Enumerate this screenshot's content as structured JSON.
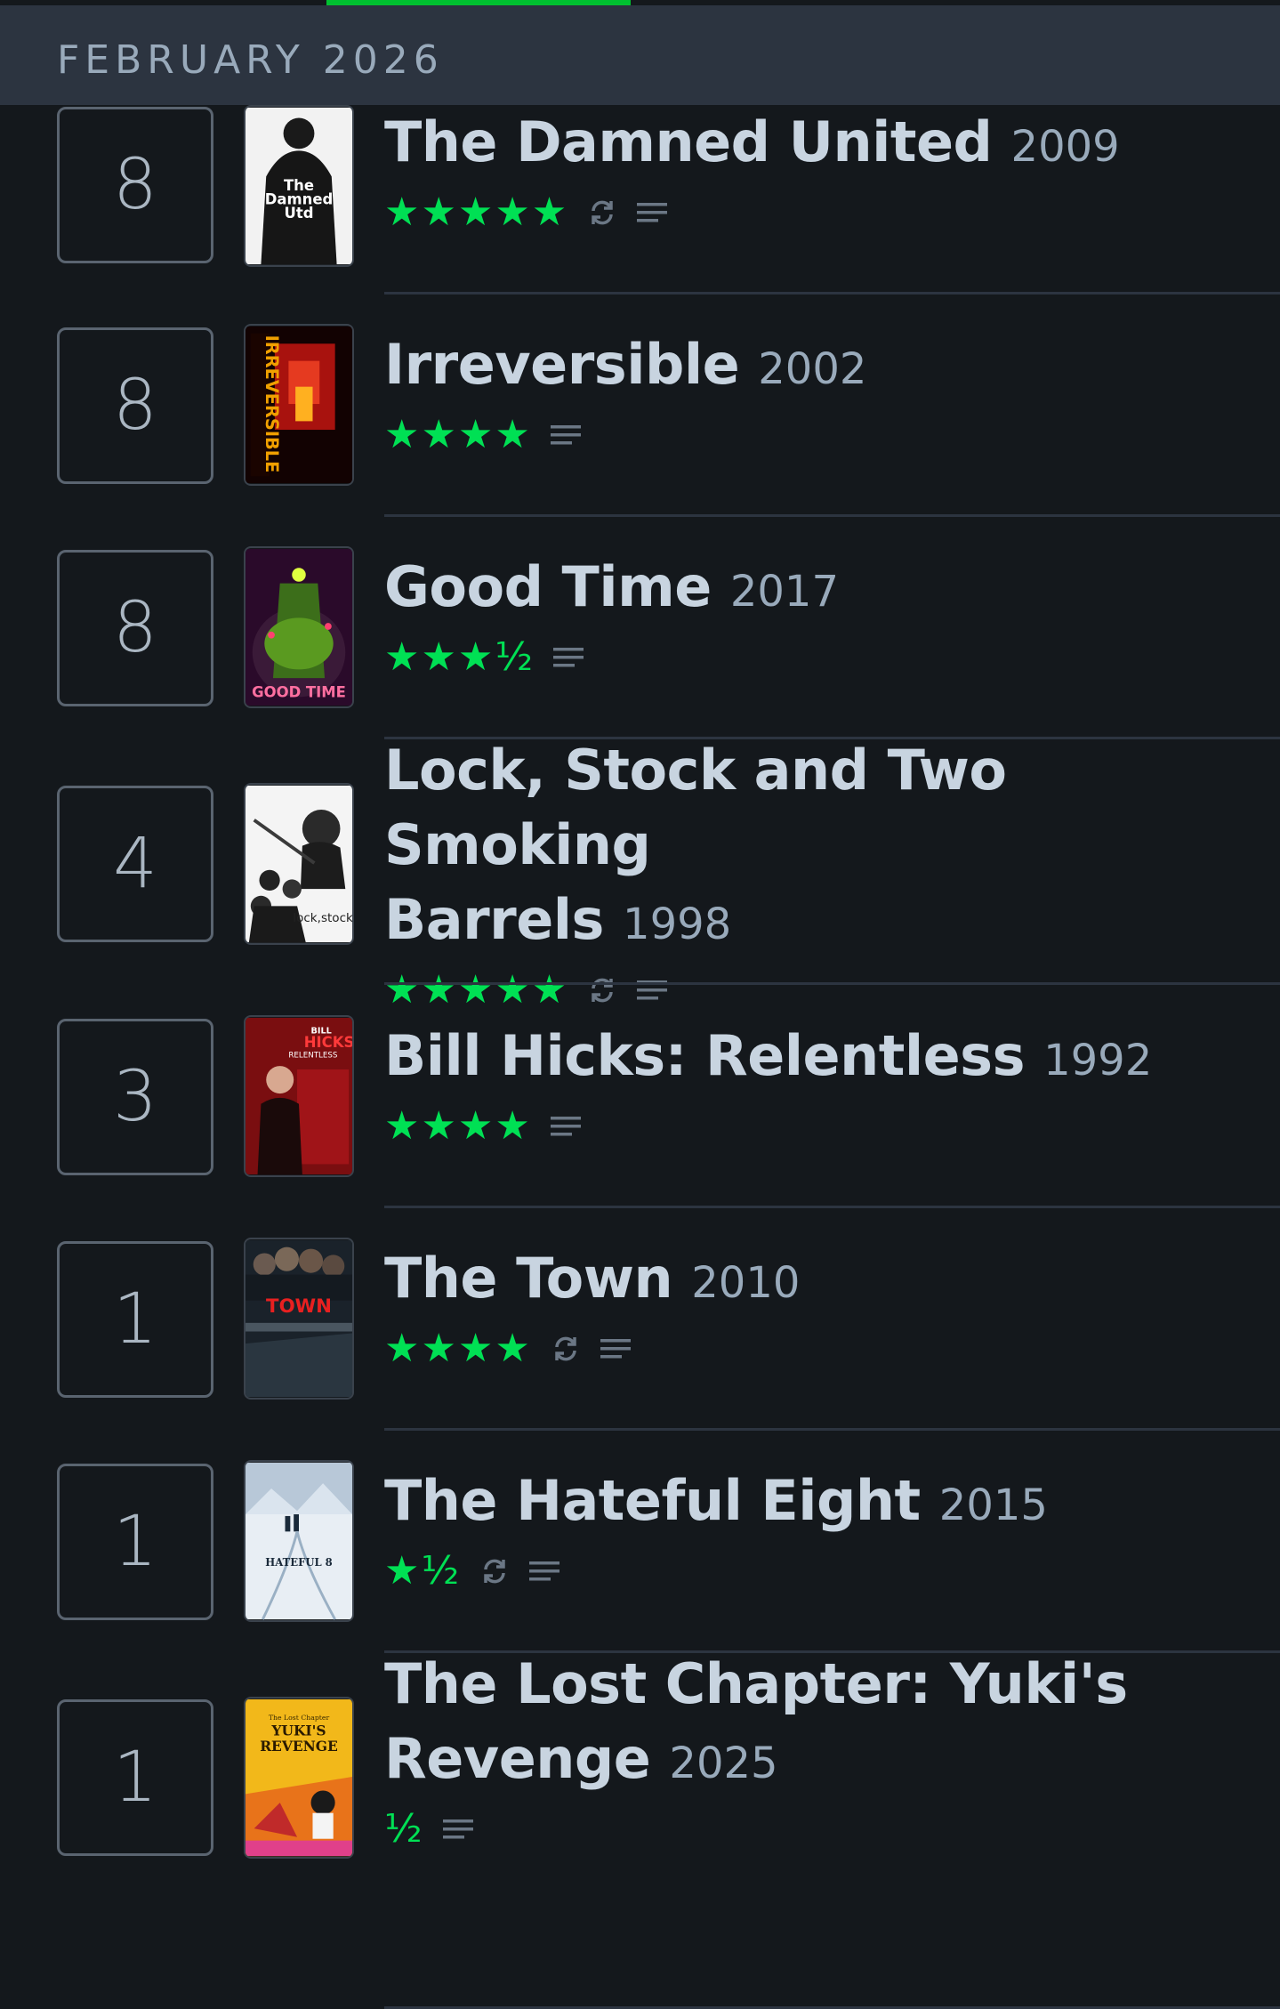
{
  "accent_color": "#00e054",
  "header": {
    "month": "FEBRUARY 2026",
    "progress_fraction": 0.17
  },
  "entries": [
    {
      "day": "8",
      "title": "The Damned United",
      "year": "2009",
      "stars": "★★★★★",
      "rating": 5,
      "rewatch": true,
      "review": true,
      "poster": "the-damned-united-poster"
    },
    {
      "day": "8",
      "title": "Irreversible",
      "year": "2002",
      "stars": "★★★★",
      "rating": 4,
      "rewatch": false,
      "review": true,
      "poster": "irreversible-poster"
    },
    {
      "day": "8",
      "title": "Good Time",
      "year": "2017",
      "stars": "★★★½",
      "rating": 3.5,
      "rewatch": false,
      "review": true,
      "poster": "good-time-poster"
    },
    {
      "day": "4",
      "title_line1": "Lock, Stock and Two Smoking",
      "title_line2": "Barrels",
      "year": "1998",
      "stars": "★★★★★",
      "rating": 5,
      "rewatch": true,
      "review": true,
      "poster": "lock-stock-poster"
    },
    {
      "day": "3",
      "title": "Bill Hicks: Relentless",
      "year": "1992",
      "stars": "★★★★",
      "rating": 4,
      "rewatch": false,
      "review": true,
      "poster": "bill-hicks-relentless-poster"
    },
    {
      "day": "1",
      "title": "The Town",
      "year": "2010",
      "stars": "★★★★",
      "rating": 4,
      "rewatch": true,
      "review": true,
      "poster": "the-town-poster"
    },
    {
      "day": "1",
      "title": "The Hateful Eight",
      "year": "2015",
      "stars": "★½",
      "rating": 1.5,
      "rewatch": true,
      "review": true,
      "poster": "the-hateful-eight-poster"
    },
    {
      "day": "1",
      "title_line1": "The Lost Chapter: Yuki's",
      "title_line2": "Revenge",
      "year": "2025",
      "stars": "½",
      "rating": 0.5,
      "rewatch": false,
      "review": true,
      "poster": "yukis-revenge-poster"
    }
  ],
  "poster_text": {
    "damned_utd": [
      "The",
      "Damned",
      "Utd"
    ],
    "irreversible": "IRREVERSIBLE",
    "good_time": "GOOD TIME",
    "lock_stock": "lock,stock",
    "bill_hicks": [
      "BILL",
      "HICKS",
      "RELENTLESS"
    ],
    "the_town": "TOWN",
    "hateful_eight": "HATEFUL 8",
    "yuki": [
      "The Lost Chapter",
      "YUKI'S",
      "REVENGE"
    ]
  }
}
